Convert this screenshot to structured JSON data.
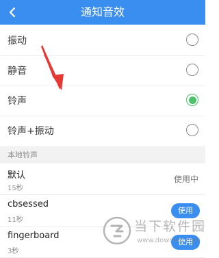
{
  "header": {
    "title": "通知音效",
    "back_icon": "chevron-left-icon"
  },
  "modes": [
    {
      "label": "振动",
      "selected": false
    },
    {
      "label": "静音",
      "selected": false
    },
    {
      "label": "铃声",
      "selected": true
    },
    {
      "label": "铃声+振动",
      "selected": false
    }
  ],
  "section_title": "本地铃声",
  "ringtones": [
    {
      "name": "默认",
      "duration": "15秒",
      "status": "使用中"
    },
    {
      "name": "cbsessed",
      "duration": "11秒",
      "action": "使用"
    },
    {
      "name": "fingerboard",
      "duration": "3秒",
      "action": "使用"
    }
  ],
  "watermark": {
    "text": "当下软件园",
    "url": "www.downxia.com"
  },
  "colors": {
    "accent": "#3a8ef0",
    "selected": "#4cc36a",
    "annotation_arrow": "#e53935"
  }
}
